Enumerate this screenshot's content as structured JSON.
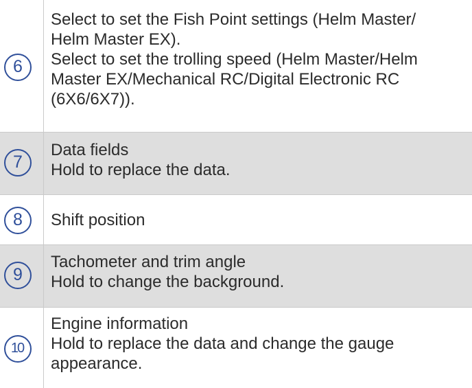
{
  "rows": [
    {
      "number": "6",
      "lines": [
        "Select to set the Fish Point settings (Helm Master/",
        "Helm Master EX).",
        "Select to set the trolling speed (Helm Master/Helm",
        "Master EX/Mechanical RC/Digital Electronic RC",
        "(6X6/6X7))."
      ]
    },
    {
      "number": "7",
      "lines": [
        "Data fields",
        "Hold to replace the data."
      ]
    },
    {
      "number": "8",
      "lines": [
        "Shift position"
      ]
    },
    {
      "number": "9",
      "lines": [
        "Tachometer and trim angle",
        "Hold to change the background."
      ]
    },
    {
      "number": "10",
      "lines": [
        "Engine information",
        "Hold to replace the data and change the gauge",
        "appearance."
      ]
    }
  ],
  "colors": {
    "shaded_row": "#dedede",
    "circle_number": "#2f4f9a",
    "border": "#c9c9c9"
  }
}
